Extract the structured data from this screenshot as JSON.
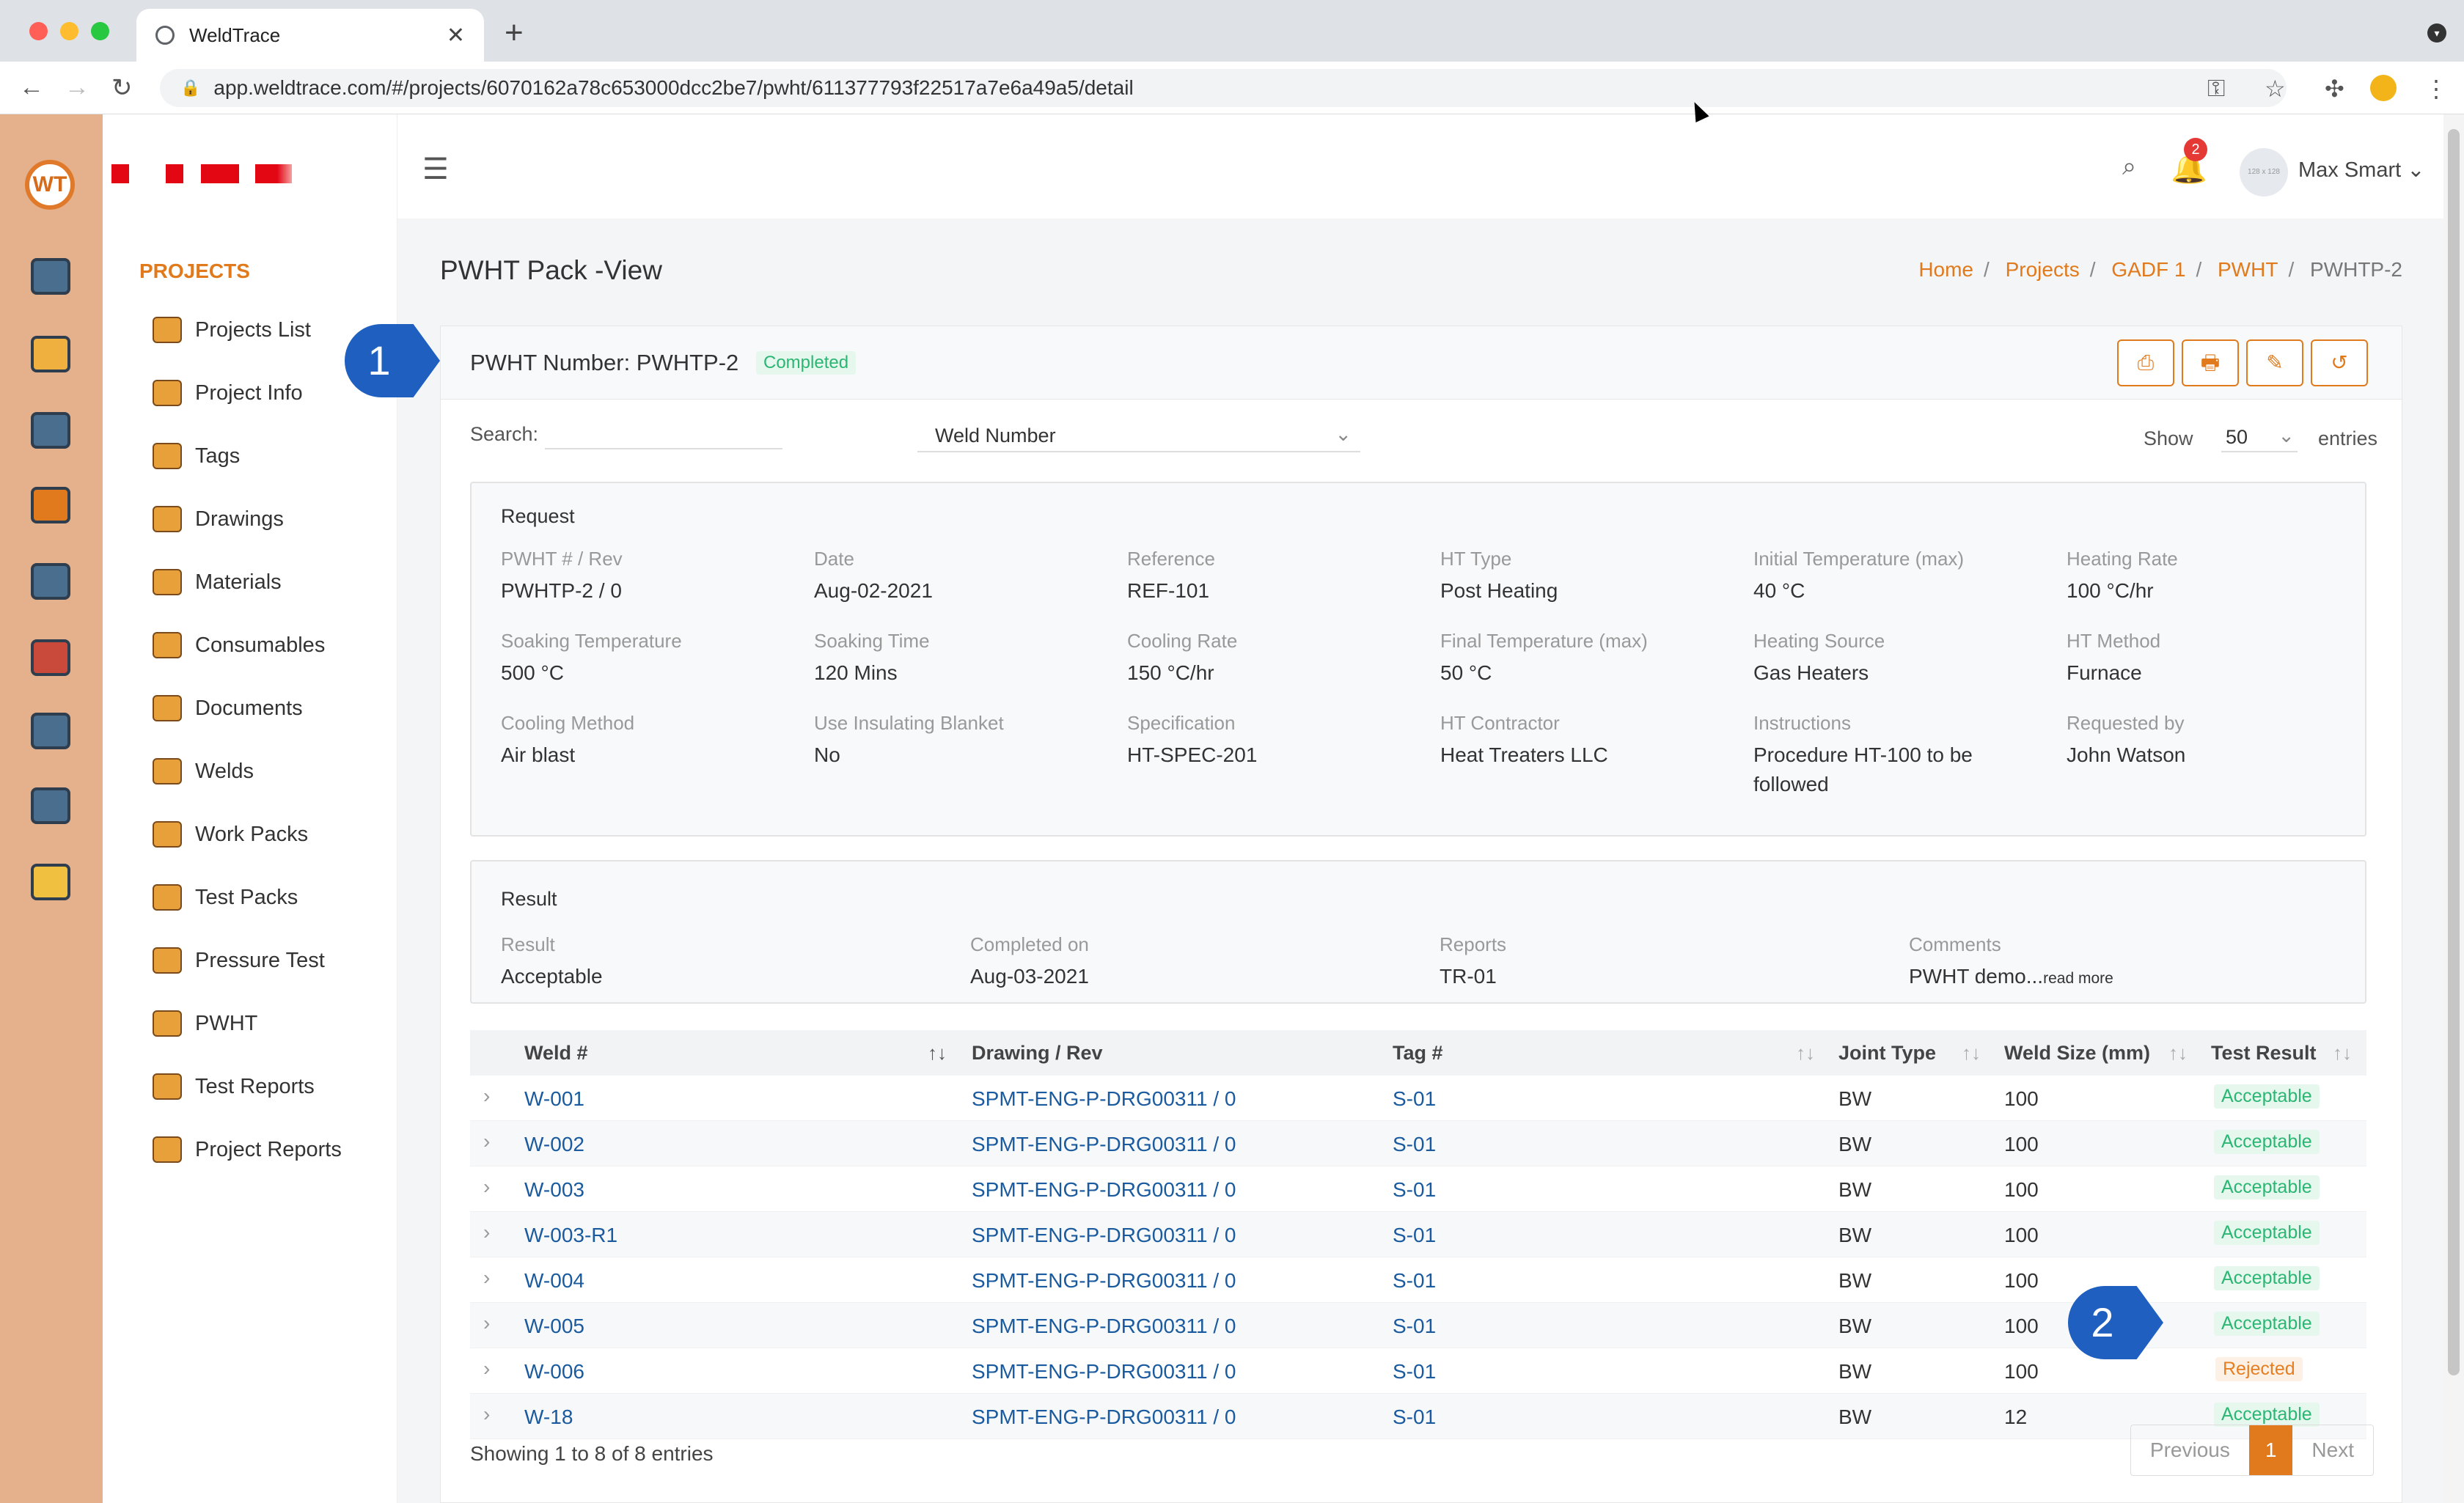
{
  "browser": {
    "tab_title": "WeldTrace",
    "url": "app.weldtrace.com/#/projects/6070162a78c653000dcc2be7/pwht/611377793f22517a7e6a49a5/detail"
  },
  "rail": {
    "logo": "WT"
  },
  "sidebar": {
    "section": "PROJECTS",
    "items": [
      {
        "label": "Projects List",
        "icon": "folder-camera-icon"
      },
      {
        "label": "Project Info",
        "icon": "gears-icon"
      },
      {
        "label": "Tags",
        "icon": "tag-icon"
      },
      {
        "label": "Drawings",
        "icon": "drawing-icon"
      },
      {
        "label": "Materials",
        "icon": "materials-icon"
      },
      {
        "label": "Consumables",
        "icon": "consumables-icon"
      },
      {
        "label": "Documents",
        "icon": "documents-icon"
      },
      {
        "label": "Welds",
        "icon": "weld-icon"
      },
      {
        "label": "Work Packs",
        "icon": "work-pack-icon"
      },
      {
        "label": "Test Packs",
        "icon": "radiation-icon"
      },
      {
        "label": "Pressure Test",
        "icon": "pressure-gauge-icon"
      },
      {
        "label": "PWHT",
        "icon": "heater-icon"
      },
      {
        "label": "Test Reports",
        "icon": "report-icon"
      },
      {
        "label": "Project Reports",
        "icon": "project-report-icon"
      }
    ]
  },
  "topbar": {
    "notifications": "2",
    "avatar_text": "128 x 128",
    "user": "Max Smart ⌄"
  },
  "page": {
    "title": "PWHT Pack -View",
    "breadcrumb": [
      "Home",
      "Projects",
      "GADF 1",
      "PWHT",
      "PWHTP-2"
    ]
  },
  "card": {
    "pwht_number": "PWHT Number: PWHTP-2",
    "status": "Completed",
    "search_label": "Search:",
    "search_value": "",
    "field_select": "Weld Number",
    "show_label": "Show",
    "show_value": "50",
    "entries_label": "entries"
  },
  "request": {
    "title": "Request",
    "fields": [
      {
        "label": "PWHT # / Rev",
        "value": "PWHTP-2 / 0"
      },
      {
        "label": "Date",
        "value": "Aug-02-2021"
      },
      {
        "label": "Reference",
        "value": "REF-101"
      },
      {
        "label": "HT Type",
        "value": "Post Heating"
      },
      {
        "label": "Initial Temperature (max)",
        "value": "40 °C"
      },
      {
        "label": "Heating Rate",
        "value": "100 °C/hr"
      },
      {
        "label": "Soaking Temperature",
        "value": "500 °C"
      },
      {
        "label": "Soaking Time",
        "value": "120 Mins"
      },
      {
        "label": "Cooling Rate",
        "value": "150 °C/hr"
      },
      {
        "label": "Final Temperature (max)",
        "value": "50 °C"
      },
      {
        "label": "Heating Source",
        "value": "Gas Heaters"
      },
      {
        "label": "HT Method",
        "value": "Furnace"
      },
      {
        "label": "Cooling Method",
        "value": "Air blast"
      },
      {
        "label": "Use Insulating Blanket",
        "value": "No"
      },
      {
        "label": "Specification",
        "value": "HT-SPEC-201"
      },
      {
        "label": "HT Contractor",
        "value": "Heat Treaters LLC"
      },
      {
        "label": "Instructions",
        "value": "Procedure HT-100 to be followed"
      },
      {
        "label": "Requested by",
        "value": "John Watson"
      }
    ]
  },
  "result": {
    "title": "Result",
    "fields": [
      {
        "label": "Result",
        "value": "Acceptable"
      },
      {
        "label": "Completed on",
        "value": "Aug-03-2021"
      },
      {
        "label": "Reports",
        "value": "TR-01"
      },
      {
        "label": "Comments",
        "value": "PWHT demo...",
        "more": "read more"
      }
    ]
  },
  "table": {
    "headers": [
      "Weld #",
      "Drawing / Rev",
      "Tag #",
      "Joint Type",
      "Weld Size (mm)",
      "Test Result"
    ],
    "rows": [
      [
        "W-001",
        "SPMT-ENG-P-DRG00311 / 0",
        "S-01",
        "BW",
        "100",
        "Acceptable"
      ],
      [
        "W-002",
        "SPMT-ENG-P-DRG00311 / 0",
        "S-01",
        "BW",
        "100",
        "Acceptable"
      ],
      [
        "W-003",
        "SPMT-ENG-P-DRG00311 / 0",
        "S-01",
        "BW",
        "100",
        "Acceptable"
      ],
      [
        "W-003-R1",
        "SPMT-ENG-P-DRG00311 / 0",
        "S-01",
        "BW",
        "100",
        "Acceptable"
      ],
      [
        "W-004",
        "SPMT-ENG-P-DRG00311 / 0",
        "S-01",
        "BW",
        "100",
        "Acceptable"
      ],
      [
        "W-005",
        "SPMT-ENG-P-DRG00311 / 0",
        "S-01",
        "BW",
        "100",
        "Acceptable"
      ],
      [
        "W-006",
        "SPMT-ENG-P-DRG00311 / 0",
        "S-01",
        "BW",
        "100",
        "Rejected"
      ],
      [
        "W-18",
        "SPMT-ENG-P-DRG00311 / 0",
        "S-01",
        "BW",
        "12",
        "Acceptable"
      ]
    ],
    "showing": "Showing 1 to 8 of 8 entries",
    "pager": {
      "prev": "Previous",
      "current": "1",
      "next": "Next"
    }
  },
  "callouts": [
    "1",
    "2"
  ],
  "colors": {
    "accent": "#e07a1c",
    "rail": "#e5b18c",
    "link": "#1a5a9e",
    "ok": "#2bb673",
    "bad": "#e67e22",
    "callout": "#1e5fbf"
  }
}
